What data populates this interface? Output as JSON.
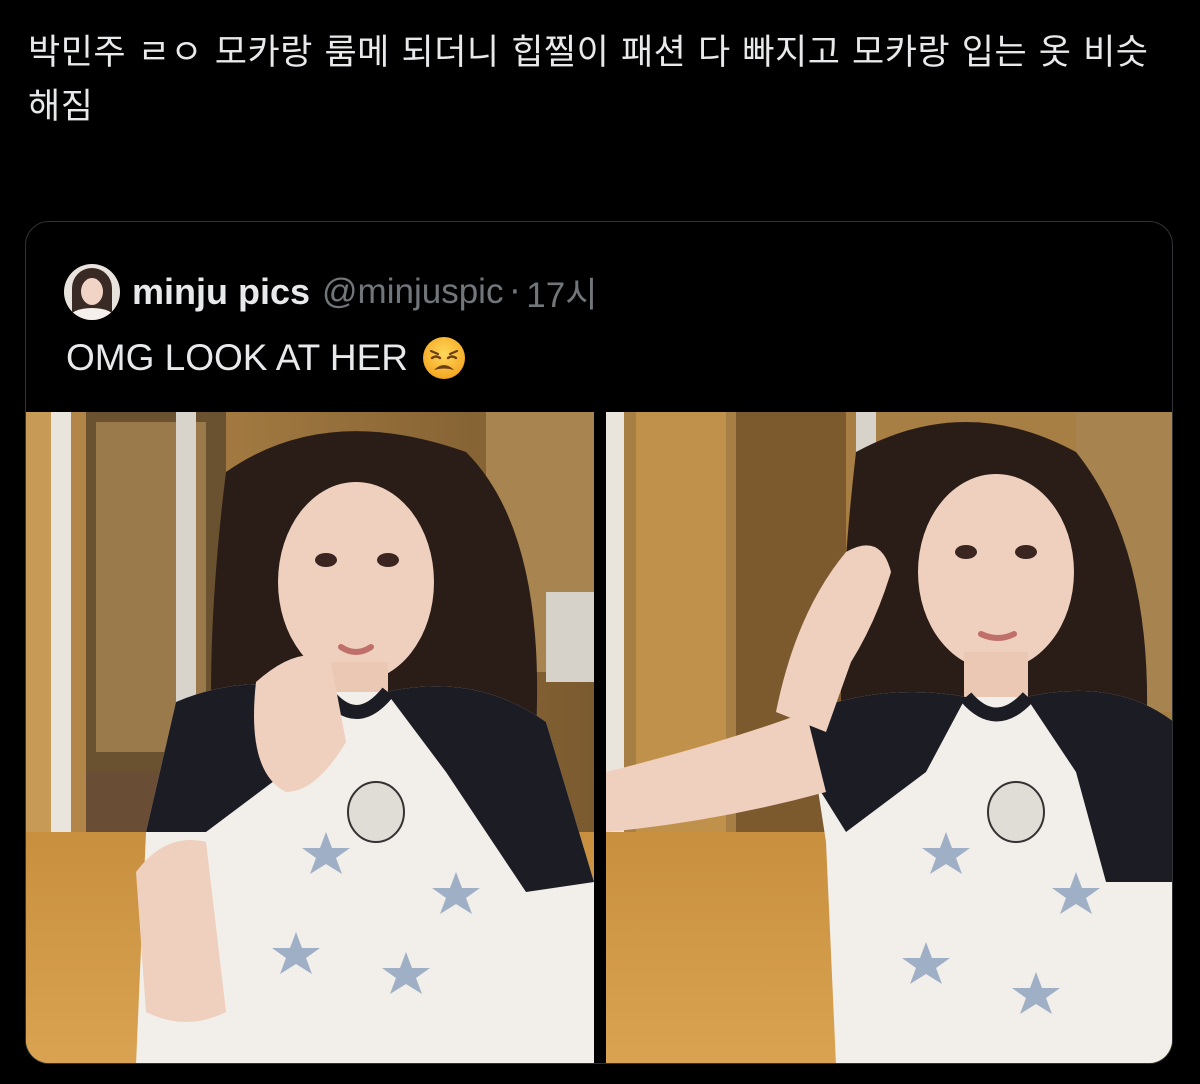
{
  "tweet": {
    "text": "박민주 ㄹㅇ 모카랑 룸메 되더니 힙찔이 패션 다 빠지고 모카랑 입는 옷 비슷해짐"
  },
  "quoted_tweet": {
    "display_name": "minju pics",
    "handle": "@minjuspic",
    "separator": "·",
    "time": "17시",
    "text": "OMG LOOK AT HER",
    "emoji": "weary-face-emoji",
    "photos": [
      {
        "subject": "photo-1"
      },
      {
        "subject": "photo-2"
      }
    ]
  },
  "colors": {
    "background": "#000000",
    "text_primary": "#e7e9ea",
    "text_secondary": "#71767b",
    "border": "#2f3336"
  }
}
